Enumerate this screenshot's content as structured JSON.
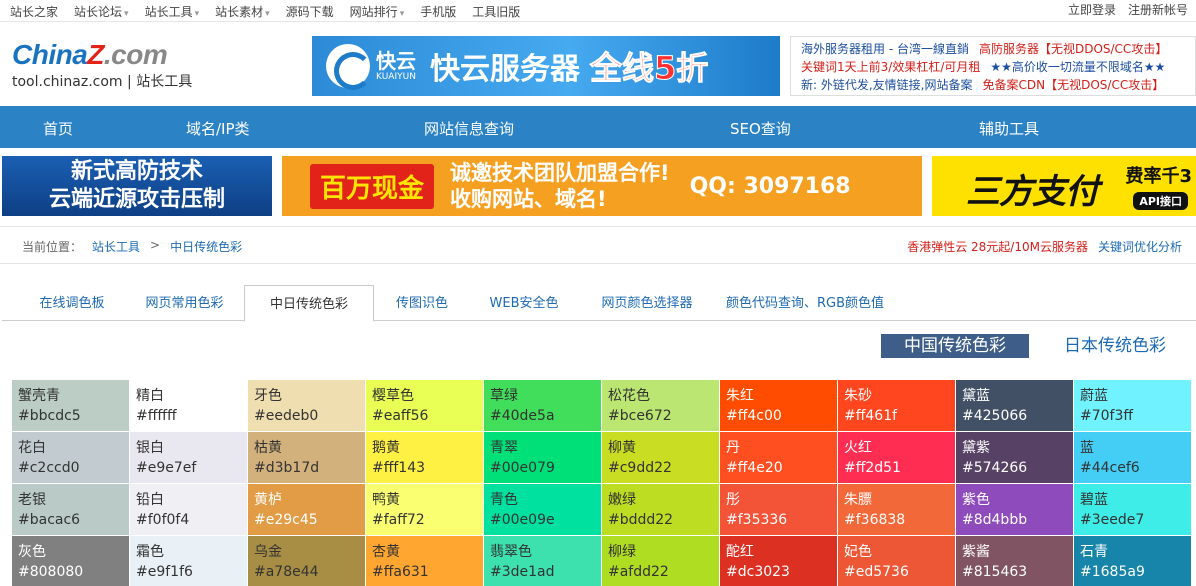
{
  "topbar": {
    "links": [
      {
        "label": "站长之家",
        "dropdown": false
      },
      {
        "label": "站长论坛",
        "dropdown": true
      },
      {
        "label": "站长工具",
        "dropdown": true
      },
      {
        "label": "站长素材",
        "dropdown": true
      },
      {
        "label": "源码下载",
        "dropdown": false
      },
      {
        "label": "网站排行",
        "dropdown": true
      },
      {
        "label": "手机版",
        "dropdown": false
      },
      {
        "label": "工具旧版",
        "dropdown": false
      }
    ],
    "login": "立即登录",
    "register": "注册新帐号"
  },
  "logo": {
    "brand_a": "China",
    "brand_z": "Z",
    "brand_b": ".com",
    "sub": "tool.chinaz.com | 站长工具"
  },
  "banner_kuaiyun": {
    "name": "快云",
    "name_en": "KUAIYUN",
    "slogan": "快云服务器",
    "offer": "全线5折"
  },
  "ad_text": {
    "rows": [
      [
        {
          "text": "海外服务器租用 - 台湾一線直銷",
          "color": "#1d4e9e"
        },
        {
          "text": "高防服务器【无视DDOS/CC攻击】",
          "color": "#d4201a"
        }
      ],
      [
        {
          "text": "关键词1天上前3/效果杠杠/可月租",
          "color": "#d4201a"
        },
        {
          "text": "★★高价收一切流量不限域名★★",
          "color": "#1d4e9e"
        }
      ],
      [
        {
          "text": "新: 外链代发,友情链接,网站备案",
          "color": "#1d4e9e"
        },
        {
          "text": "免备案CDN【无视DOS/CC攻击】",
          "color": "#d4201a"
        }
      ]
    ]
  },
  "nav": [
    "首页",
    "域名/IP类",
    "网站信息查询",
    "SEO查询",
    "辅助工具"
  ],
  "banners": {
    "b1_line1": "新式高防技术",
    "b1_line2": "云端近源攻击压制",
    "b2_money": "百万现金",
    "b2_line1": "诚邀技术团队加盟合作!",
    "b2_line2": "收购网站、域名!",
    "b2_qq": "QQ: 3097168",
    "b3_main": "三方支付",
    "b3_rate": "费率千3",
    "b3_api": "API接口"
  },
  "breadcrumb": {
    "label": "当前位置：",
    "level1": "站长工具",
    "sep": ">",
    "level2": "中日传统色彩",
    "ad1": "香港弹性云 28元起/10M云服务器",
    "ad2": "关键词优化分析"
  },
  "tabs": [
    "在线调色板",
    "网页常用色彩",
    "中日传统色彩",
    "传图识色",
    "WEB安全色",
    "网页颜色选择器",
    "颜色代码查询、RGB颜色值"
  ],
  "active_tab": 2,
  "toggle": {
    "cn": "中国传统色彩",
    "jp": "日本传统色彩"
  },
  "colors": [
    {
      "name": "蟹壳青",
      "hex": "#bbcdc5",
      "dark": false
    },
    {
      "name": "精白",
      "hex": "#ffffff",
      "dark": false
    },
    {
      "name": "牙色",
      "hex": "#eedeb0",
      "dark": false
    },
    {
      "name": "樱草色",
      "hex": "#eaff56",
      "dark": false
    },
    {
      "name": "草绿",
      "hex": "#40de5a",
      "dark": false
    },
    {
      "name": "松花色",
      "hex": "#bce672",
      "dark": false
    },
    {
      "name": "朱红",
      "hex": "#ff4c00",
      "dark": true
    },
    {
      "name": "朱砂",
      "hex": "#ff461f",
      "dark": true
    },
    {
      "name": "黛蓝",
      "hex": "#425066",
      "dark": true
    },
    {
      "name": "蔚蓝",
      "hex": "#70f3ff",
      "dark": false
    },
    {
      "name": "花白",
      "hex": "#c2ccd0",
      "dark": false
    },
    {
      "name": "银白",
      "hex": "#e9e7ef",
      "dark": false
    },
    {
      "name": "枯黄",
      "hex": "#d3b17d",
      "dark": false
    },
    {
      "name": "鹅黄",
      "hex": "#fff143",
      "dark": false
    },
    {
      "name": "青翠",
      "hex": "#00e079",
      "dark": false
    },
    {
      "name": "柳黄",
      "hex": "#c9dd22",
      "dark": false
    },
    {
      "name": "丹",
      "hex": "#ff4e20",
      "dark": true
    },
    {
      "name": "火红",
      "hex": "#ff2d51",
      "dark": true
    },
    {
      "name": "黛紫",
      "hex": "#574266",
      "dark": true
    },
    {
      "name": "蓝",
      "hex": "#44cef6",
      "dark": false
    },
    {
      "name": "老银",
      "hex": "#bacac6",
      "dark": false
    },
    {
      "name": "铅白",
      "hex": "#f0f0f4",
      "dark": false
    },
    {
      "name": "黄栌",
      "hex": "#e29c45",
      "dark": true
    },
    {
      "name": "鸭黄",
      "hex": "#faff72",
      "dark": false
    },
    {
      "name": "青色",
      "hex": "#00e09e",
      "dark": false
    },
    {
      "name": "嫩绿",
      "hex": "#bddd22",
      "dark": false
    },
    {
      "name": "彤",
      "hex": "#f35336",
      "dark": true
    },
    {
      "name": "朱膘",
      "hex": "#f36838",
      "dark": true
    },
    {
      "name": "紫色",
      "hex": "#8d4bbb",
      "dark": true
    },
    {
      "name": "碧蓝",
      "hex": "#3eede7",
      "dark": false
    },
    {
      "name": "灰色",
      "hex": "#808080",
      "dark": true
    },
    {
      "name": "霜色",
      "hex": "#e9f1f6",
      "dark": false
    },
    {
      "name": "乌金",
      "hex": "#a78e44",
      "dark": false
    },
    {
      "name": "杏黄",
      "hex": "#ffa631",
      "dark": false
    },
    {
      "name": "翡翠色",
      "hex": "#3de1ad",
      "dark": false
    },
    {
      "name": "柳绿",
      "hex": "#afdd22",
      "dark": false
    },
    {
      "name": "酡红",
      "hex": "#dc3023",
      "dark": true
    },
    {
      "name": "妃色",
      "hex": "#ed5736",
      "dark": true
    },
    {
      "name": "紫酱",
      "hex": "#815463",
      "dark": true
    },
    {
      "name": "石青",
      "hex": "#1685a9",
      "dark": true
    }
  ]
}
